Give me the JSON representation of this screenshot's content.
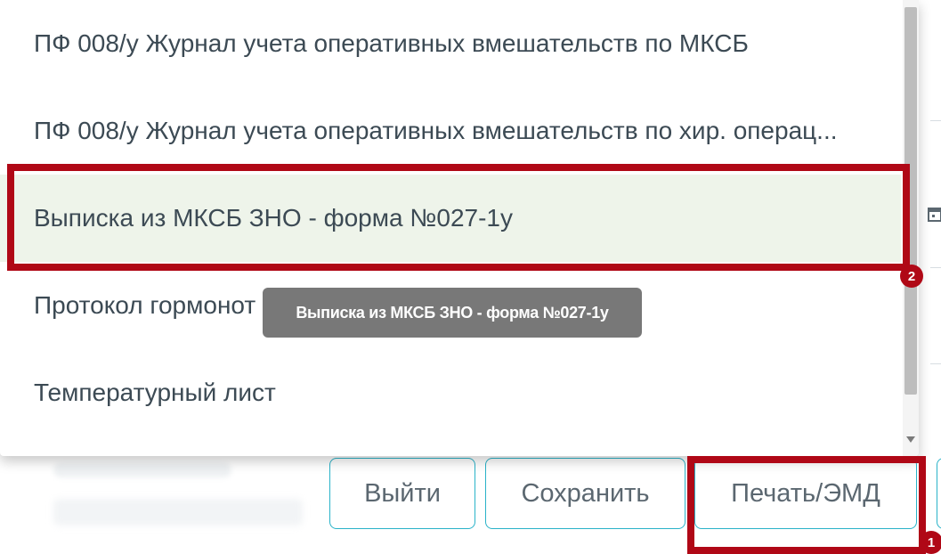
{
  "dropdown": {
    "items": [
      {
        "label": "ПФ 008/у Журнал учета оперативных вмешательств по МКСБ"
      },
      {
        "label": "ПФ 008/у Журнал учета оперативных вмешательств по хир. операц..."
      },
      {
        "label": "Выписка из МКСБ ЗНО - форма №027-1у",
        "selected": true
      },
      {
        "label": "Протокол гормонот"
      },
      {
        "label": "Температурный лист"
      }
    ]
  },
  "tooltip": {
    "text": "Выписка из МКСБ ЗНО - форма №027-1у"
  },
  "footer": {
    "exit_label": "Выйти",
    "save_label": "Сохранить",
    "print_label": "Печать/ЭМД"
  },
  "annotations": {
    "badge_1": "1",
    "badge_2": "2",
    "color": "#b00816"
  },
  "colors": {
    "accent_border": "#2ab3c9",
    "selected_bg": "#eef4ea",
    "tooltip_bg": "#6c6c6c"
  },
  "icons": [
    "calendar-icon",
    "scroll-down-arrow-icon"
  ]
}
